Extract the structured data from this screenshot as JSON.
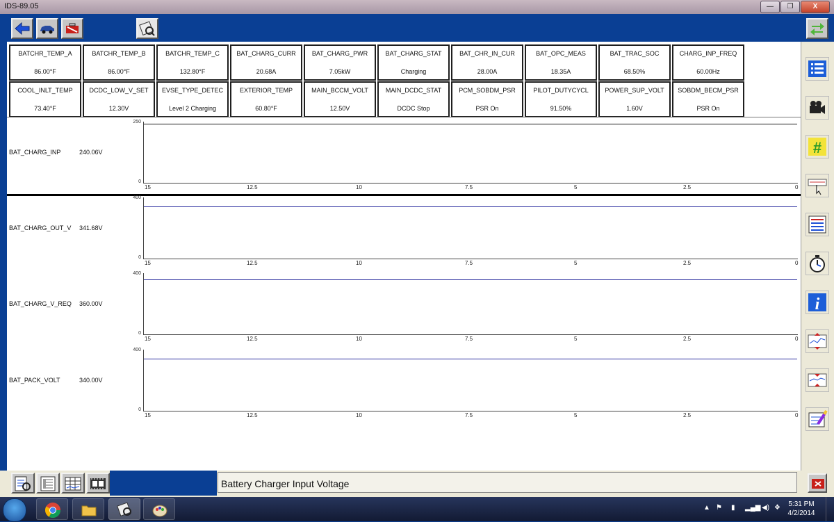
{
  "window": {
    "title": "IDS-89.05",
    "controls": [
      "—",
      "❐",
      "X"
    ]
  },
  "pids": [
    {
      "name": "BATCHR_TEMP_A",
      "value": "86.00°F"
    },
    {
      "name": "BATCHR_TEMP_B",
      "value": "86.00°F"
    },
    {
      "name": "BATCHR_TEMP_C",
      "value": "132.80°F"
    },
    {
      "name": "BAT_CHARG_CURR",
      "value": "20.68A"
    },
    {
      "name": "BAT_CHARG_PWR",
      "value": "7.05kW"
    },
    {
      "name": "BAT_CHARG_STAT",
      "value": "Charging"
    },
    {
      "name": "BAT_CHR_IN_CUR",
      "value": "28.00A"
    },
    {
      "name": "BAT_OPC_MEAS",
      "value": "18.35A"
    },
    {
      "name": "BAT_TRAC_SOC",
      "value": "68.50%"
    },
    {
      "name": "CHARG_INP_FREQ",
      "value": "60.00Hz"
    },
    {
      "name": "COOL_INLT_TEMP",
      "value": "73.40°F"
    },
    {
      "name": "DCDC_LOW_V_SET",
      "value": "12.30V"
    },
    {
      "name": "EVSE_TYPE_DETEC",
      "value": "Level 2 Charging"
    },
    {
      "name": "EXTERIOR_TEMP",
      "value": "60.80°F"
    },
    {
      "name": "MAIN_BCCM_VOLT",
      "value": "12.50V"
    },
    {
      "name": "MAIN_DCDC_STAT",
      "value": "DCDC Stop"
    },
    {
      "name": "PCM_SOBDM_PSR",
      "value": "PSR On"
    },
    {
      "name": "PILOT_DUTYCYCL",
      "value": "91.50%"
    },
    {
      "name": "POWER_SUP_VOLT",
      "value": "1.60V"
    },
    {
      "name": "SOBDM_BECM_PSR",
      "value": "PSR On"
    }
  ],
  "chart_data": [
    {
      "type": "line",
      "title": "BAT_CHARG_INP",
      "current_value": "240.06V",
      "ylim": [
        0,
        250
      ],
      "xlim": [
        15,
        0
      ],
      "x_ticks": [
        "15",
        "12.5",
        "10",
        "7.5",
        "5",
        "2.5",
        "0"
      ],
      "series": [
        {
          "values": [
            240.06,
            240.06
          ],
          "x": [
            15,
            0
          ],
          "color": "#1a1a1a"
        }
      ]
    },
    {
      "type": "line",
      "title": "BAT_CHARG_OUT_V",
      "current_value": "341.68V",
      "ylim": [
        0,
        400
      ],
      "xlim": [
        15,
        0
      ],
      "x_ticks": [
        "15",
        "12.5",
        "10",
        "7.5",
        "5",
        "2.5",
        "0"
      ],
      "series": [
        {
          "values": [
            341.68,
            341.68
          ],
          "x": [
            15,
            0
          ],
          "color": "#2a2d9e"
        }
      ]
    },
    {
      "type": "line",
      "title": "BAT_CHARG_V_REQ",
      "current_value": "360.00V",
      "ylim": [
        0,
        400
      ],
      "xlim": [
        15,
        0
      ],
      "x_ticks": [
        "15",
        "12.5",
        "10",
        "7.5",
        "5",
        "2.5",
        "0"
      ],
      "series": [
        {
          "values": [
            360,
            360
          ],
          "x": [
            15,
            0
          ],
          "color": "#2a2d9e"
        }
      ]
    },
    {
      "type": "line",
      "title": "BAT_PACK_VOLT",
      "current_value": "340.00V",
      "ylim": [
        0,
        400
      ],
      "xlim": [
        15,
        0
      ],
      "x_ticks": [
        "15",
        "12.5",
        "10",
        "7.5",
        "5",
        "2.5",
        "0"
      ],
      "series": [
        {
          "values": [
            340,
            340
          ],
          "x": [
            15,
            0
          ],
          "color": "#2a2d9e"
        }
      ]
    }
  ],
  "toolbar": {
    "buttons": [
      "back-arrow-icon",
      "vehicle-icon",
      "toolbox-icon",
      "datalogger-icon",
      "swap-arrows-icon"
    ]
  },
  "sidebar": {
    "buttons": [
      "pid-list-icon",
      "recorder-camera-icon",
      "grid-hash-icon",
      "graph-cursor-icon",
      "pid-select-icon",
      "stopwatch-icon",
      "info-icon",
      "graph-scale-up-icon",
      "graph-scale-down-icon",
      "clear-data-icon"
    ]
  },
  "bottombar": {
    "buttons": [
      "pid-view-icon",
      "pid-graph-icon",
      "pid-table-icon",
      "filmstrip-icon"
    ],
    "status_text": "Battery Charger Input Voltage",
    "exit_icon": "exit-icon"
  },
  "taskbar": {
    "apps": [
      "windows-start-icon",
      "chrome-icon",
      "folder-icon",
      "ids-app-icon",
      "paint-icon"
    ],
    "time": "5:31 PM",
    "date": "4/2/2014"
  },
  "colors": {
    "app_blue": "#0a3f94",
    "sidebar_bg": "#ece9d8",
    "trace_blue": "#2a2d9e"
  }
}
